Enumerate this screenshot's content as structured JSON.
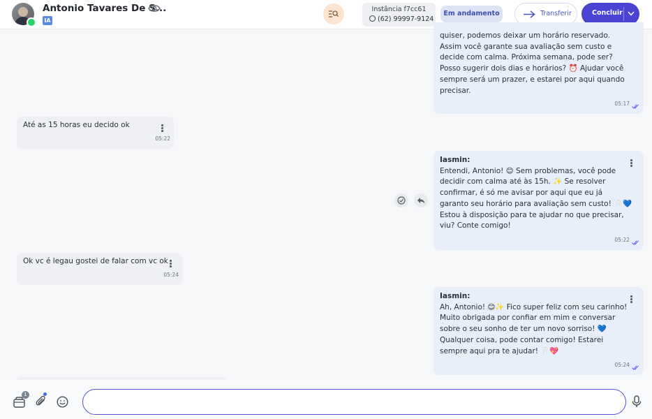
{
  "header": {
    "contact_name": "Antonio Tavares De S...",
    "ia_badge": "IA",
    "instance_name": "Instância f7cc61",
    "instance_phone": "(62) 99997-9124",
    "status": "Em andamento",
    "transfer_label": "Transferir",
    "conclude_label": "Concluir"
  },
  "messages": [
    {
      "direction": "out",
      "author": "",
      "text": "quiser, podemos deixar um horário reservado.\nAssim você garante sua avaliação sem custo e\ndecide com calma. Próxima semana, pode ser?\nPosso sugerir dois dias e horários? ⏰ Ajudar você\nsempre será um prazer, e estarei por aqui quando\nprecisar.",
      "time": "05:17"
    },
    {
      "direction": "in",
      "text": "Até as 15 horas eu decido ok",
      "time": "05:22"
    },
    {
      "direction": "out",
      "author": "Iasmin:",
      "text": "Entendi, Antonio! 😊 Sem problemas, você pode\ndecidir com calma até às 15h. ✨ Se resolver\nconfirmar, é só me avisar por aqui que eu já\ngaranto seu horário para avaliação sem custo! 🦷💙\nEstou à disposição para te ajudar no que precisar,\nviu? Conte comigo!",
      "time": "05:22"
    },
    {
      "direction": "in",
      "text": "Ok vc é legau gostei de falar com vc ok",
      "time": "05:24"
    },
    {
      "direction": "out",
      "author": "Iasmin:",
      "text": "Ah, Antonio! 😊✨ Fico super feliz com seu carinho!\nMuito obrigada por confiar em mim e conversar\nsobre o seu sonho de ter um novo sorriso! 💙\nQualquer coisa, pode contar comigo! Estarei\nsempre aqui pra te ajudar! 🦷💖",
      "time": "05:24"
    }
  ],
  "composer": {
    "notification_count": "1",
    "placeholder": ""
  },
  "colors": {
    "accent": "#4a43d4",
    "incoming_bubble": "#eef0f4",
    "outgoing_bubble": "#e9eefb",
    "read_ticks": "#6a5cf0"
  }
}
